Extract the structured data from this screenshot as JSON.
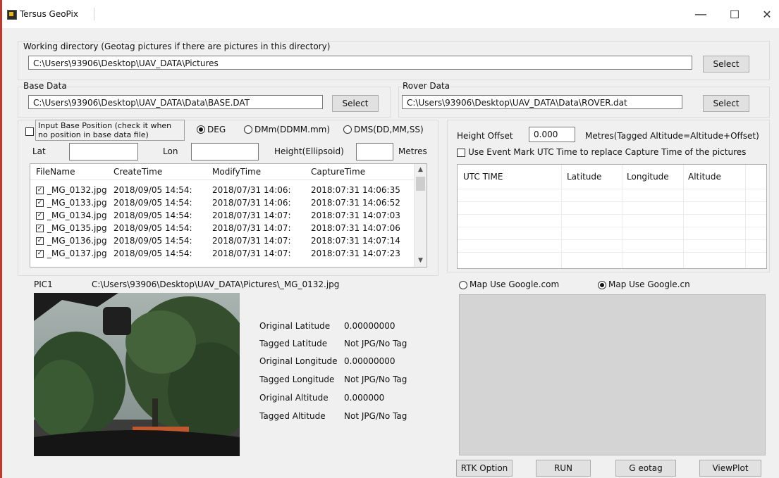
{
  "window": {
    "title": "Tersus GeoPix",
    "controls": {
      "minimize": "—",
      "maximize": "☐",
      "close": "✕"
    }
  },
  "working_dir": {
    "label": "Working directory (Geotag pictures if there are pictures in this directory)",
    "value": "C:\\Users\\93906\\Desktop\\UAV_DATA\\Pictures",
    "select_label": "Select"
  },
  "base_data": {
    "label": "Base Data",
    "value": "C:\\Users\\93906\\Desktop\\UAV_DATA\\Data\\BASE.DAT",
    "select_label": "Select"
  },
  "rover_data": {
    "label": "Rover Data",
    "value": "C:\\Users\\93906\\Desktop\\UAV_DATA\\Data\\ROVER.dat",
    "select_label": "Select"
  },
  "base_position": {
    "checkbox_label_line1": "Input Base Position (check it when",
    "checkbox_label_line2": "no position in base data file)",
    "checked": false,
    "format_options": [
      "DEG",
      "DMm(DDMM.mm)",
      "DMS(DD,MM,SS)"
    ],
    "selected_format": "DEG",
    "lat_label": "Lat",
    "lon_label": "Lon",
    "height_label": "Height(Ellipsoid)",
    "units_label": "Metres",
    "lat_value": "",
    "lon_value": "",
    "height_value": ""
  },
  "file_list": {
    "columns": [
      "FileName",
      "CreateTime",
      "ModifyTime",
      "CaptureTime"
    ],
    "rows": [
      {
        "checked": true,
        "cells": [
          "_MG_0132.jpg",
          "2018/09/05 14:54:",
          "2018/07/31 14:06:",
          "2018:07:31 14:06:35"
        ]
      },
      {
        "checked": true,
        "cells": [
          "_MG_0133.jpg",
          "2018/09/05 14:54:",
          "2018/07/31 14:06:",
          "2018:07:31 14:06:52"
        ]
      },
      {
        "checked": true,
        "cells": [
          "_MG_0134.jpg",
          "2018/09/05 14:54:",
          "2018/07/31 14:07:",
          "2018:07:31 14:07:03"
        ]
      },
      {
        "checked": true,
        "cells": [
          "_MG_0135.jpg",
          "2018/09/05 14:54:",
          "2018/07/31 14:07:",
          "2018:07:31 14:07:06"
        ]
      },
      {
        "checked": true,
        "cells": [
          "_MG_0136.jpg",
          "2018/09/05 14:54:",
          "2018/07/31 14:07:",
          "2018:07:31 14:07:14"
        ]
      },
      {
        "checked": true,
        "cells": [
          "_MG_0137.jpg",
          "2018/09/05 14:54:",
          "2018/07/31 14:07:",
          "2018:07:31 14:07:23"
        ]
      }
    ]
  },
  "height_offset": {
    "label": "Height Offset",
    "value": "0.000",
    "formula": "Metres(Tagged Altitude=Altitude+Offset)"
  },
  "event_mark": {
    "label": "Use Event Mark UTC Time to replace Capture Time of the pictures",
    "checked": false
  },
  "utc_table": {
    "columns": [
      "UTC TIME",
      "Latitude",
      "Longitude",
      "Altitude"
    ]
  },
  "picture": {
    "label": "PIC1",
    "path": "C:\\Users\\93906\\Desktop\\UAV_DATA\\Pictures\\_MG_0132.jpg"
  },
  "picture_info": [
    {
      "label": "Original Latitude",
      "value": "0.00000000"
    },
    {
      "label": "Tagged Latitude",
      "value": "Not JPG/No Tag"
    },
    {
      "label": "Original Longitude",
      "value": "0.00000000"
    },
    {
      "label": "Tagged Longitude",
      "value": "Not JPG/No Tag"
    },
    {
      "label": "Original Altitude",
      "value": "0.000000"
    },
    {
      "label": "Tagged Altitude",
      "value": "Not JPG/No Tag"
    }
  ],
  "map": {
    "options": [
      "Map Use Google.com",
      "Map Use Google.cn"
    ],
    "selected": "Map Use Google.cn"
  },
  "actions": {
    "rtk_option": "RTK Option",
    "run": "RUN",
    "geotag": "G eotag",
    "viewplot": "ViewPlot"
  },
  "colors": {
    "window_bg": "#f0f0f0",
    "button_bg": "#e1e1e1",
    "map_bg": "#d4d4d4"
  }
}
